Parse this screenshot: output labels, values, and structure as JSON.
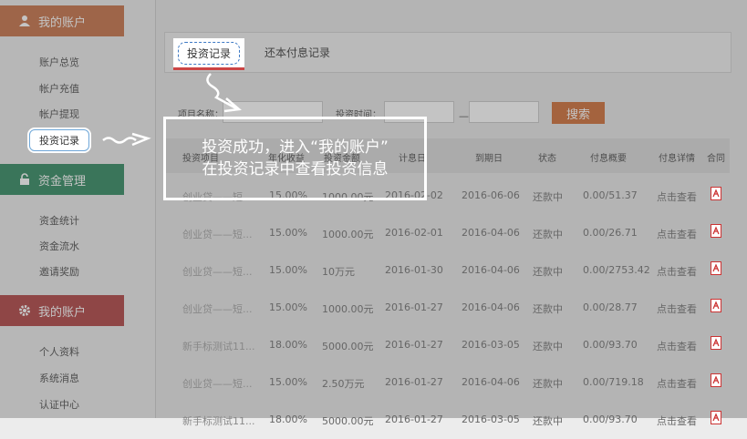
{
  "sidebar": {
    "section1_title": "我的账户",
    "section1_items": [
      "账户总览",
      "帐户充值",
      "帐户提现",
      "投资记录"
    ],
    "section2_title": "资金管理",
    "section2_items": [
      "资金统计",
      "资金流水",
      "邀请奖励"
    ],
    "section3_title": "我的账户",
    "section3_items": [
      "个人资料",
      "系统消息",
      "认证中心"
    ]
  },
  "tabs": [
    "投资记录",
    "还本付息记录"
  ],
  "filters": {
    "project_label": "项目名称：",
    "time_label": "投资时间：",
    "range_separator": "—",
    "search_button": "搜索"
  },
  "table": {
    "headers": [
      "投资项目",
      "年化收益",
      "投资金额",
      "计息日",
      "到期日",
      "状态",
      "付息概要",
      "付息详情",
      "合同"
    ],
    "rows": [
      [
        "创业贷——短...",
        "15.00%",
        "1000.00元",
        "2016-02-02",
        "2016-06-06",
        "还款中",
        "0.00/51.37",
        "点击查看"
      ],
      [
        "创业贷——短...",
        "15.00%",
        "1000.00元",
        "2016-02-01",
        "2016-04-06",
        "还款中",
        "0.00/26.71",
        "点击查看"
      ],
      [
        "创业贷——短...",
        "15.00%",
        "10万元",
        "2016-01-30",
        "2016-04-06",
        "还款中",
        "0.00/2753.42",
        "点击查看"
      ],
      [
        "创业贷——短...",
        "15.00%",
        "1000.00元",
        "2016-01-27",
        "2016-04-06",
        "还款中",
        "0.00/28.77",
        "点击查看"
      ],
      [
        "新手标测试11...",
        "18.00%",
        "5000.00元",
        "2016-01-27",
        "2016-03-05",
        "还款中",
        "0.00/93.70",
        "点击查看"
      ],
      [
        "创业贷——短...",
        "15.00%",
        "2.50万元",
        "2016-01-27",
        "2016-04-06",
        "还款中",
        "0.00/719.18",
        "点击查看"
      ],
      [
        "新手标测试11...",
        "18.00%",
        "5000.00元",
        "2016-01-27",
        "2016-03-05",
        "还款中",
        "0.00/93.70",
        "点击查看"
      ]
    ]
  },
  "callout": {
    "line1": "投资成功，进入“我的账户”",
    "line2": "在投资记录中查看投资信息"
  },
  "colors": {
    "accent_orange": "#d2743f",
    "green": "#3a8e67",
    "red": "#b34b4b",
    "highlight_blue": "#3d79c4"
  }
}
